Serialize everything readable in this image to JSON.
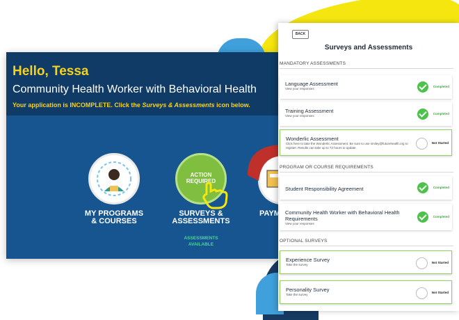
{
  "dashboard": {
    "greeting": "Hello, Tessa",
    "program_name": "Community Health Worker with Behavioral Health",
    "status_prefix": "Your application is INCOMPLETE. Click the ",
    "status_emph": "Surveys & Assessments",
    "status_suffix": " icon below.",
    "tiles": [
      {
        "label_line1": "MY PROGRAMS",
        "label_line2": "& COURSES"
      },
      {
        "badge_line1": "ACTION",
        "badge_line2": "REQUIRED",
        "label_line1": "SURVEYS &",
        "label_line2": "ASSESSMENTS",
        "sub_line1": "ASSESSMENTS",
        "sub_line2": "AVAILABLE"
      },
      {
        "label_line1": "PAYM"
      }
    ]
  },
  "panel": {
    "back_label": "BACK",
    "title": "Surveys and Assessments",
    "sections": [
      {
        "heading": "MANDATORY ASSESSMENTS",
        "items": [
          {
            "title": "Language Assessment",
            "subtitle": "View your responses",
            "status": "Completed"
          },
          {
            "title": "Training Assessment",
            "subtitle": "View your responses",
            "status": "Completed"
          },
          {
            "title": "Wonderlic Assessment",
            "subtitle": "Click here to take the Wonderlic Assessment. Be sure to use smiley@futurehealth.org to register. Results can take up to 72 hours to update.",
            "status": "Not Started"
          }
        ]
      },
      {
        "heading": "PROGRAM OR COURSE REQUIREMENTS",
        "items": [
          {
            "title": "Student Responsibility Agreement",
            "subtitle": "",
            "status": "Completed"
          },
          {
            "title": "Community Health Worker with Behavioral Health Requirements",
            "subtitle": "View your responses",
            "status": "Completed"
          }
        ]
      },
      {
        "heading": "OPTIONAL SURVEYS",
        "items": [
          {
            "title": "Experience Survey",
            "subtitle": "Take the survey",
            "status": "Not Started"
          },
          {
            "title": "Personality Survey",
            "subtitle": "Take the survey",
            "status": "Not Started"
          }
        ]
      }
    ]
  },
  "colors": {
    "accent_yellow": "#f7d21c",
    "navy": "#0f3b66",
    "completed_green": "#4cc24a",
    "arrow_red": "#c0302a"
  }
}
